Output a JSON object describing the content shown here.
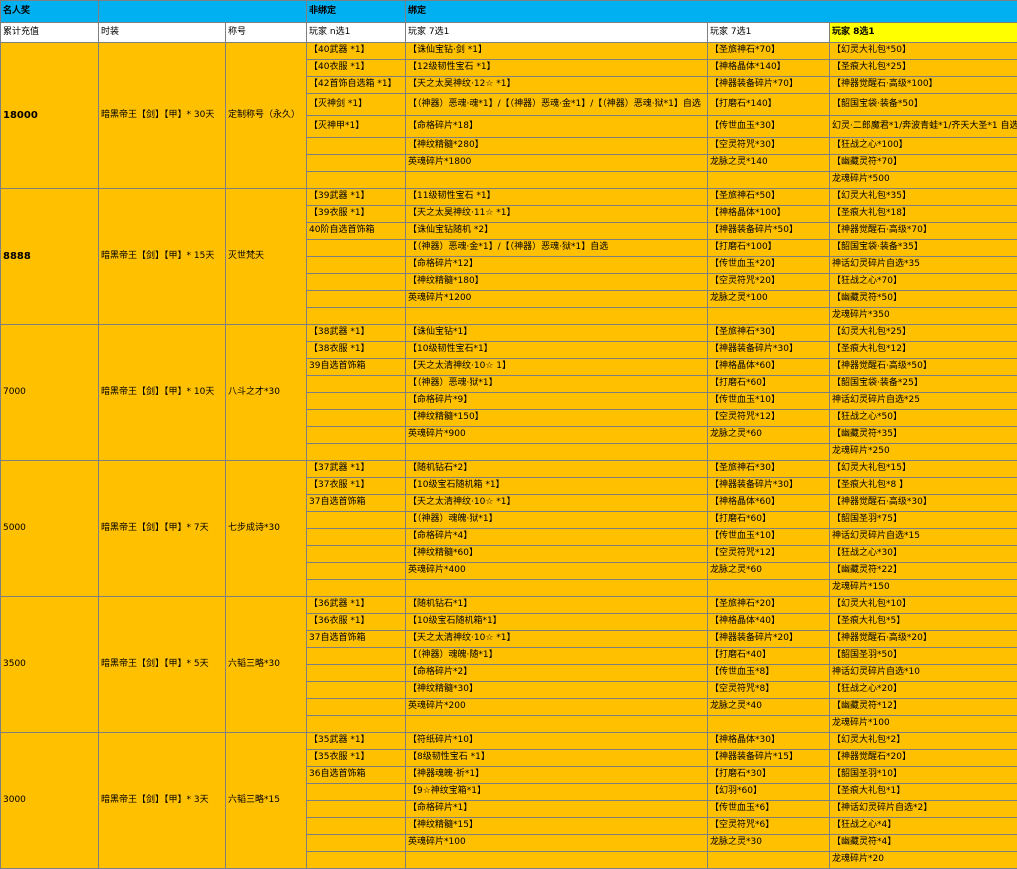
{
  "header": {
    "group_celebrity": "名人奖",
    "group_unbound": "非绑定",
    "group_bound": "绑定",
    "col_recharge": "累计充值",
    "col_fashion": "时装",
    "col_title": "称号",
    "col_unbound": "玩家  n选1",
    "col_pick7a": "玩家  7选1",
    "col_pick7b": "玩家  7选1",
    "col_pick8": "玩家  8选1"
  },
  "tiers": [
    {
      "amount": "18000",
      "amount_bold": true,
      "fashion": "暗黑帝王【剑】【甲】* 30天",
      "title": "定制称号（永久）",
      "rows": [
        [
          "【40武器 *1】",
          "【诛仙宝钻·剑 *1】",
          "【圣旅神石*70】",
          "【幻灵大礼包*50】"
        ],
        [
          "【40衣服 *1】",
          "【12级韧性宝石 *1】",
          "【神格晶体*140】",
          "【圣痕大礼包*25】"
        ],
        [
          "【42首饰自选箱 *1】",
          "【天之太昊神纹·12☆ *1】",
          "【神器装备碎片*70】",
          "【神器觉醒石·高级*100】"
        ],
        [
          "【灭神剑 *1】",
          "【（神器）恶魂·魂*1】/【（神器）恶魂·金*1】/【（神器）恶魂·狱*1】自选",
          "【打磨石*140】",
          "【韶国宝袋·装备*50】"
        ],
        [
          "【灭神甲*1】",
          "【命格碎片*18】",
          "【传世血玉*30】",
          "幻灵·二郎魔君*1/奔波青蛙*1/齐天大圣*1 自选"
        ],
        [
          "",
          "【神纹精髓*280】",
          "【空灵符咒*30】",
          "【狂战之心*100】"
        ],
        [
          "",
          "英魂碎片*1800",
          "龙脉之灵*140",
          "【幽藏灵符*70】"
        ],
        [
          "",
          "",
          "",
          "龙魂碎片*500"
        ]
      ]
    },
    {
      "amount": "8888",
      "amount_bold": true,
      "fashion": "暗黑帝王【剑】【甲】* 15天",
      "title": "灭世梵天",
      "rows": [
        [
          "【39武器 *1】",
          "【11级韧性宝石 *1】",
          "【圣旅神石*50】",
          "【幻灵大礼包*35】"
        ],
        [
          "【39衣服 *1】",
          "【天之太昊神纹·11☆ *1】",
          "【神格晶体*100】",
          "【圣痕大礼包*18】"
        ],
        [
          "40阶自选首饰箱",
          "【诛仙宝钻随机 *2】",
          "【神器装备碎片*50】",
          "【神器觉醒石·高级*70】"
        ],
        [
          "",
          "【（神器）恶魂·金*1】/【（神器）恶魂·狱*1】自选",
          "【打磨石*100】",
          "【韶国宝袋·装备*35】"
        ],
        [
          "",
          "【命格碎片*12】",
          "【传世血玉*20】",
          "神话幻灵碎片自选*35"
        ],
        [
          "",
          "【神纹精髓*180】",
          "【空灵符咒*20】",
          "【狂战之心*70】"
        ],
        [
          "",
          "英魂碎片*1200",
          "龙脉之灵*100",
          "【幽藏灵符*50】"
        ],
        [
          "",
          "",
          "",
          "龙魂碎片*350"
        ]
      ]
    },
    {
      "amount": "7000",
      "amount_bold": false,
      "fashion": "暗黑帝王【剑】【甲】* 10天",
      "title": "八斗之才*30",
      "rows": [
        [
          "【38武器 *1】",
          "【诛仙宝钻*1】",
          "【圣旅神石*30】",
          "【幻灵大礼包*25】"
        ],
        [
          "【38衣服 *1】",
          "【10级韧性宝石*1】",
          "【神器装备碎片*30】",
          "【圣痕大礼包*12】"
        ],
        [
          "39自选首饰箱",
          "【天之太清神纹·10☆ 1】",
          "【神格晶体*60】",
          "【神器觉醒石·高级*50】"
        ],
        [
          "",
          "【（神器）恶魂·狱*1】",
          "【打磨石*60】",
          "【韶国宝袋·装备*25】"
        ],
        [
          "",
          "【命格碎片*9】",
          "【传世血玉*10】",
          "神话幻灵碎片自选*25"
        ],
        [
          "",
          "【神纹精髓*150】",
          "【空灵符咒*12】",
          "【狂战之心*50】"
        ],
        [
          "",
          "英魂碎片*900",
          "龙脉之灵*60",
          "【幽藏灵符*35】"
        ],
        [
          "",
          "",
          "",
          "龙魂碎片*250"
        ]
      ]
    },
    {
      "amount": "5000",
      "amount_bold": false,
      "fashion": "暗黑帝王【剑】【甲】* 7天",
      "title": "七步成诗*30",
      "rows": [
        [
          "【37武器 *1】",
          "【随机钻石*2】",
          "【圣旅神石*30】",
          "【幻灵大礼包*15】"
        ],
        [
          "【37衣服 *1】",
          "【10级宝石随机箱 *1】",
          "【神器装备碎片*30】",
          "【圣痕大礼包*8 】"
        ],
        [
          "37自选首饰箱",
          "【天之太清神纹·10☆ *1】",
          "【神格晶体*60】",
          "【神器觉醒石·高级*30】"
        ],
        [
          "",
          "【（神器）魂魄·狱*1】",
          "【打磨石*60】",
          "【韶国圣羽*75】"
        ],
        [
          "",
          "【命格碎片*4】",
          "【传世血玉*10】",
          "神话幻灵碎片自选*15"
        ],
        [
          "",
          "【神纹精髓*60】",
          "【空灵符咒*12】",
          "【狂战之心*30】"
        ],
        [
          "",
          "英魂碎片*400",
          "龙脉之灵*60",
          "【幽藏灵符*22】"
        ],
        [
          "",
          "",
          "",
          "龙魂碎片*150"
        ]
      ]
    },
    {
      "amount": "3500",
      "amount_bold": false,
      "fashion": "暗黑帝王【剑】【甲】* 5天",
      "title": "六韬三略*30",
      "rows": [
        [
          "【36武器 *1】",
          "【随机钻石*1】",
          "【圣旅神石*20】",
          "【幻灵大礼包*10】"
        ],
        [
          "【36衣服 *1】",
          "【10级宝石随机箱*1】",
          "【神格晶体*40】",
          "【圣痕大礼包*5】"
        ],
        [
          "37自选首饰箱",
          "【天之太清神纹·10☆ *1】",
          "【神器装备碎片*20】",
          "【神器觉醒石·高级*20】"
        ],
        [
          "",
          "【（神器）魂魄·随*1】",
          "【打磨石*40】",
          "【韶国圣羽*50】"
        ],
        [
          "",
          "【命格碎片*2】",
          "【传世血玉*8】",
          "神话幻灵碎片自选*10"
        ],
        [
          "",
          "【神纹精髓*30】",
          "【空灵符咒*8】",
          "【狂战之心*20】"
        ],
        [
          "",
          "英魂碎片*200",
          "龙脉之灵*40",
          "【幽藏灵符*12】"
        ],
        [
          "",
          "",
          "",
          "龙魂碎片*100"
        ]
      ]
    },
    {
      "amount": "3000",
      "amount_bold": false,
      "fashion": "暗黑帝王【剑】【甲】* 3天",
      "title": "六韬三略*15",
      "rows": [
        [
          "【35武器 *1】",
          "【符纸碎片*10】",
          "【神格晶体*30】",
          "【幻灵大礼包*2】"
        ],
        [
          "【35衣服 *1】",
          "【8级韧性宝石 *1】",
          "【神器装备碎片*15】",
          "【神器觉醒石*20】"
        ],
        [
          "36自选首饰箱",
          "【神器魂魄·祈*1】",
          "【打磨石*30】",
          "【韶国圣羽*10】"
        ],
        [
          "",
          "【9☆神纹宝箱*1】",
          "【幻羽*60】",
          "【圣痕大礼包*1】"
        ],
        [
          "",
          "【命格碎片*1】",
          "【传世血玉*6】",
          "【神话幻灵碎片自选*2】"
        ],
        [
          "",
          "【神纹精髓*15】",
          "【空灵符咒*6】",
          "【狂战之心*4】"
        ],
        [
          "",
          "英魂碎片*100",
          "龙脉之灵*30",
          "【幽藏灵符*4】"
        ],
        [
          "",
          "",
          "",
          "龙魂碎片*20"
        ]
      ]
    }
  ]
}
